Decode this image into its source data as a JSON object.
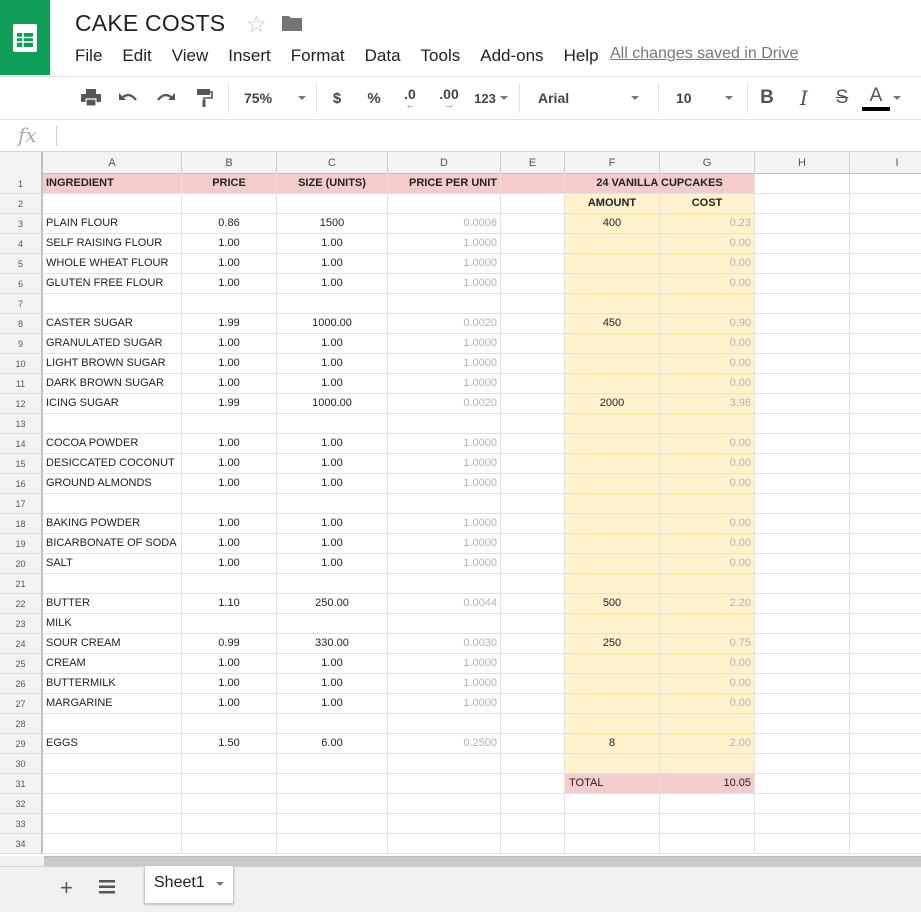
{
  "header": {
    "title": "CAKE COSTS",
    "menu": [
      "File",
      "Edit",
      "View",
      "Insert",
      "Format",
      "Data",
      "Tools",
      "Add-ons",
      "Help"
    ],
    "saved_status": "All changes saved in Drive",
    "brand_color": "#0f9d58"
  },
  "toolbar": {
    "zoom": "75%",
    "currency": "$",
    "percent": "%",
    "decrease_decimal": ".0",
    "increase_decimal": ".00",
    "number_format": "123",
    "font": "Arial",
    "font_size": "10",
    "bold": "B",
    "italic": "I",
    "strikethrough": "S",
    "text_color": "A"
  },
  "formula_bar": {
    "fx": "fx"
  },
  "sheet": {
    "columns": [
      "A",
      "B",
      "C",
      "D",
      "E",
      "F",
      "G",
      "H",
      "I"
    ],
    "rows": [
      {
        "n": "1",
        "A": "INGREDIENT",
        "B": "PRICE",
        "C": "SIZE (UNITS)",
        "D": "PRICE PER UNIT",
        "E": "",
        "FG": "24 VANILLA CUPCAKES"
      },
      {
        "n": "2",
        "A": "",
        "B": "",
        "C": "",
        "D": "",
        "F": "AMOUNT",
        "G": "COST"
      },
      {
        "n": "3",
        "A": "PLAIN FLOUR",
        "B": "0.86",
        "C": "1500",
        "D": "0.0006",
        "F": "400",
        "G": "0.23"
      },
      {
        "n": "4",
        "A": "SELF RAISING FLOUR",
        "B": "1.00",
        "C": "1.00",
        "D": "1.0000",
        "F": "",
        "G": "0.00"
      },
      {
        "n": "5",
        "A": "WHOLE WHEAT FLOUR",
        "B": "1.00",
        "C": "1.00",
        "D": "1.0000",
        "F": "",
        "G": "0.00"
      },
      {
        "n": "6",
        "A": "GLUTEN FREE FLOUR",
        "B": "1.00",
        "C": "1.00",
        "D": "1.0000",
        "F": "",
        "G": "0.00"
      },
      {
        "n": "7",
        "A": "",
        "B": "",
        "C": "",
        "D": "",
        "F": "",
        "G": ""
      },
      {
        "n": "8",
        "A": "CASTER SUGAR",
        "B": "1.99",
        "C": "1000.00",
        "D": "0.0020",
        "F": "450",
        "G": "0.90"
      },
      {
        "n": "9",
        "A": "GRANULATED SUGAR",
        "B": "1.00",
        "C": "1.00",
        "D": "1.0000",
        "F": "",
        "G": "0.00"
      },
      {
        "n": "10",
        "A": "LIGHT BROWN SUGAR",
        "B": "1.00",
        "C": "1.00",
        "D": "1.0000",
        "F": "",
        "G": "0.00"
      },
      {
        "n": "11",
        "A": "DARK BROWN SUGAR",
        "B": "1.00",
        "C": "1.00",
        "D": "1.0000",
        "F": "",
        "G": "0.00"
      },
      {
        "n": "12",
        "A": "ICING SUGAR",
        "B": "1.99",
        "C": "1000.00",
        "D": "0.0020",
        "F": "2000",
        "G": "3.98"
      },
      {
        "n": "13",
        "A": "",
        "B": "",
        "C": "",
        "D": "",
        "F": "",
        "G": ""
      },
      {
        "n": "14",
        "A": "COCOA POWDER",
        "B": "1.00",
        "C": "1.00",
        "D": "1.0000",
        "F": "",
        "G": "0.00"
      },
      {
        "n": "15",
        "A": "DESICCATED COCONUT",
        "B": "1.00",
        "C": "1.00",
        "D": "1.0000",
        "F": "",
        "G": "0.00"
      },
      {
        "n": "16",
        "A": "GROUND ALMONDS",
        "B": "1.00",
        "C": "1.00",
        "D": "1.0000",
        "F": "",
        "G": "0.00"
      },
      {
        "n": "17",
        "A": "",
        "B": "",
        "C": "",
        "D": "",
        "F": "",
        "G": ""
      },
      {
        "n": "18",
        "A": "BAKING POWDER",
        "B": "1.00",
        "C": "1.00",
        "D": "1.0000",
        "F": "",
        "G": "0.00"
      },
      {
        "n": "19",
        "A": "BICARBONATE OF SODA",
        "B": "1.00",
        "C": "1.00",
        "D": "1.0000",
        "F": "",
        "G": "0.00"
      },
      {
        "n": "20",
        "A": "SALT",
        "B": "1.00",
        "C": "1.00",
        "D": "1.0000",
        "F": "",
        "G": "0.00"
      },
      {
        "n": "21",
        "A": "",
        "B": "",
        "C": "",
        "D": "",
        "F": "",
        "G": ""
      },
      {
        "n": "22",
        "A": "BUTTER",
        "B": "1.10",
        "C": "250.00",
        "D": "0.0044",
        "F": "500",
        "G": "2.20"
      },
      {
        "n": "23",
        "A": "MILK",
        "B": "",
        "C": "",
        "D": "",
        "F": "",
        "G": ""
      },
      {
        "n": "24",
        "A": "SOUR CREAM",
        "B": "0.99",
        "C": "330.00",
        "D": "0.0030",
        "F": "250",
        "G": "0.75"
      },
      {
        "n": "25",
        "A": "CREAM",
        "B": "1.00",
        "C": "1.00",
        "D": "1.0000",
        "F": "",
        "G": "0.00"
      },
      {
        "n": "26",
        "A": "BUTTERMILK",
        "B": "1.00",
        "C": "1.00",
        "D": "1.0000",
        "F": "",
        "G": "0.00"
      },
      {
        "n": "27",
        "A": "MARGARINE",
        "B": "1.00",
        "C": "1.00",
        "D": "1.0000",
        "F": "",
        "G": "0.00"
      },
      {
        "n": "28",
        "A": "",
        "B": "",
        "C": "",
        "D": "",
        "F": "",
        "G": ""
      },
      {
        "n": "29",
        "A": "EGGS",
        "B": "1.50",
        "C": "6.00",
        "D": "0.2500",
        "F": "8",
        "G": "2.00"
      },
      {
        "n": "30",
        "A": "",
        "B": "",
        "C": "",
        "D": ""
      },
      {
        "n": "31",
        "A": "",
        "B": "",
        "C": "",
        "D": "",
        "F": "TOTAL",
        "G": "10.05"
      },
      {
        "n": "32"
      },
      {
        "n": "33"
      },
      {
        "n": "34"
      }
    ]
  },
  "sheet_tabs": {
    "active": "Sheet1"
  },
  "colors": {
    "header_fill": "#f4cccc",
    "cupcake_fill": "#fff2cc",
    "computed_text": "#b3b3b3"
  }
}
